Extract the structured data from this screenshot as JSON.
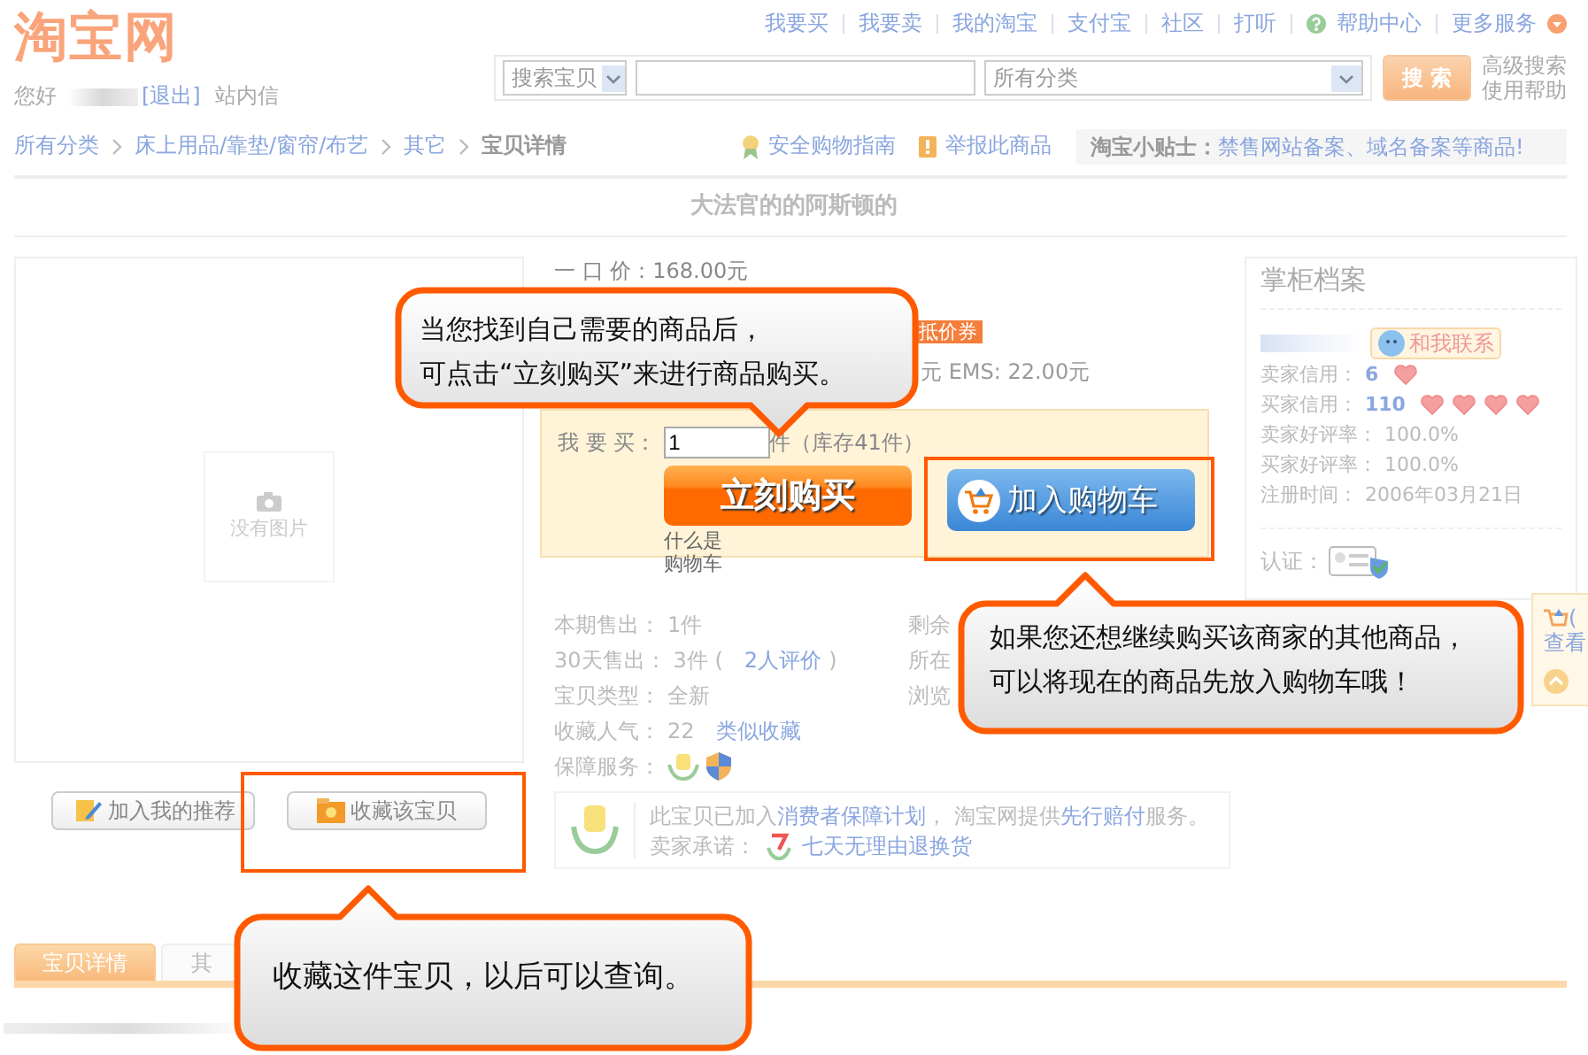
{
  "header": {
    "logo": "淘宝网",
    "greeting": "您好",
    "logout": "[退出]",
    "messages": "站内信",
    "top_links": [
      {
        "label": "我要买",
        "kind": "plain"
      },
      {
        "label": "我要卖",
        "kind": "plain"
      },
      {
        "label": "我的淘宝",
        "kind": "plain"
      },
      {
        "label": "支付宝",
        "kind": "plain"
      },
      {
        "label": "社区",
        "kind": "plain"
      },
      {
        "label": "打听",
        "kind": "plain"
      },
      {
        "label": "帮助中心",
        "kind": "help"
      },
      {
        "label": "更多服务",
        "kind": "more"
      }
    ],
    "search": {
      "scope": "搜索宝贝",
      "category": "所有分类",
      "button": "搜 索",
      "side_links": [
        "高级搜索",
        "使用帮助"
      ]
    }
  },
  "breadcrumb": {
    "items": [
      "所有分类",
      "床上用品/靠垫/窗帘/布艺",
      "其它",
      "宝贝详情"
    ]
  },
  "links": [
    {
      "label": "安全购物指南",
      "kind": "guide"
    },
    {
      "label": "举报此商品",
      "kind": "report"
    }
  ],
  "tip": {
    "label": "淘宝小贴士：",
    "text": "禁售网站备案、域名备案等商品!"
  },
  "item_title": "大法官的的阿斯顿的",
  "gallery": {
    "no_image": "没有图片",
    "buttons": [
      {
        "label": "加入我的推荐",
        "kind": "recommend"
      },
      {
        "label": "收藏该宝贝",
        "kind": "favorite"
      }
    ]
  },
  "price": {
    "label": "一 口 价：",
    "value": "168.00元",
    "coupon": "抵价券",
    "shipping": "元 EMS: 22.00元"
  },
  "buy": {
    "label": "我 要 买：",
    "quantity": "1",
    "unit": "件",
    "stock": "（库存41件）",
    "buy_now": "立刻购买",
    "add_to_cart": "加入购物车",
    "cart_help": [
      "什么是",
      "购物车"
    ]
  },
  "stats": [
    {
      "label": "本期售出：",
      "value": "1件"
    },
    {
      "label": "30天售出：",
      "value": "3件 (",
      "link": "2人评价",
      "after": ")"
    },
    {
      "label": "宝贝类型：",
      "value": "全新"
    },
    {
      "label": "收藏人气：",
      "value": "22",
      "link": "类似收藏"
    },
    {
      "label": "保障服务："
    }
  ],
  "stats_right": [
    "剩余",
    "所在",
    "浏览"
  ],
  "guarantee": {
    "text": "此宝贝已加入**消费者保障计划**， 淘宝网提供**先行赔付**服务。",
    "promise_label": "卖家承诺：",
    "promise": "七天无理由退换货"
  },
  "seller": {
    "title": "掌柜档案",
    "contact": "和我联系",
    "rows": [
      {
        "label": "卖家信用：",
        "value": "6",
        "kind": "seller_credit"
      },
      {
        "label": "买家信用：",
        "value": "110",
        "kind": "buyer_credit"
      },
      {
        "label": "卖家好评率：",
        "value": "100.0%",
        "kind": "plain"
      },
      {
        "label": "买家好评率：",
        "value": "100.0%",
        "kind": "plain"
      },
      {
        "label": "注册时间：",
        "value": "2006年03月21日",
        "kind": "plain"
      }
    ],
    "cert": "认证："
  },
  "side_widget": {
    "cart": "(",
    "view": "查看"
  },
  "tabs": [
    {
      "label": "宝贝详情",
      "selected": true
    },
    {
      "label": "其",
      "selected": false
    }
  ],
  "callouts": [
    {
      "lines": [
        "当您找到自己需要的商品后，",
        "可点击“立刻购买”来进行商品购买。"
      ],
      "kind": "down"
    },
    {
      "lines": [
        "如果您还想继续购买该商家的其他商品，",
        "可以将现在的商品先放入购物车哦！"
      ],
      "kind": "up"
    },
    {
      "lines": [
        "收藏这件宝贝，以后可以查询。"
      ],
      "kind": "up"
    }
  ]
}
